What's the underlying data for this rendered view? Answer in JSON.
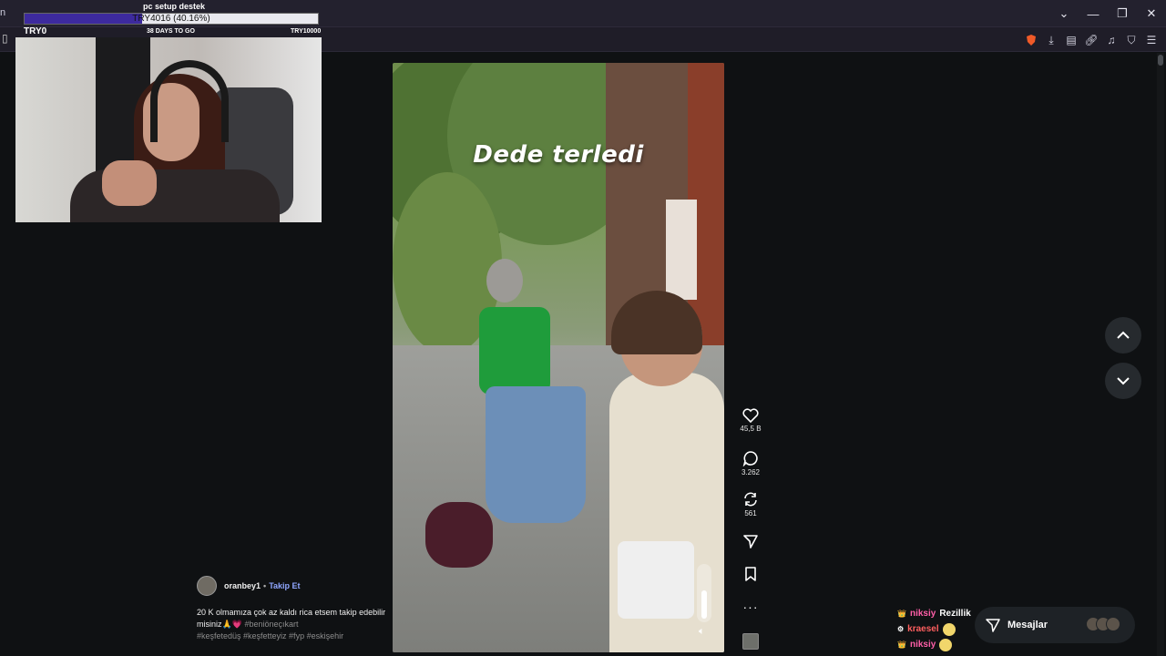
{
  "browser": {
    "tab_stub": "n",
    "window_controls": [
      "chevron-down",
      "minimize",
      "restore",
      "close"
    ],
    "toolbar_icons": [
      "brave-shield-icon",
      "download-icon",
      "save-icon",
      "link-icon",
      "music-icon",
      "shield-icon",
      "menu-icon"
    ]
  },
  "donation": {
    "title": "pc setup destek",
    "amount": "TRY4016 (40.16%)",
    "progress": 0.4016,
    "current": "TRY0",
    "days_left": "38 DAYS TO GO",
    "goal": "TRY10000",
    "fill_color": "#3d2a9e"
  },
  "video": {
    "caption": "Dede terledi",
    "volume": 0.55
  },
  "actions": {
    "likes": "45,5 B",
    "comments": "3.262",
    "reposts": "561"
  },
  "post": {
    "author": "oranbey1",
    "separator": "•",
    "follow_label": "Takip Et",
    "text": "20 K olmamıza çok az kaldı rica etsem takip edebilir misiniz🙏💗",
    "tags_inline": "#beniöneçıkart",
    "tags_line": "#keşfetedüş #keşfetteyiz #fyp #eskişehir"
  },
  "chat": [
    {
      "user": "niksiy",
      "message": "Rezillik",
      "badges": "👑"
    },
    {
      "user": "kraesel",
      "message": "",
      "badges": "⚙"
    },
    {
      "user": "niksiy",
      "message": "",
      "badges": "👑"
    }
  ],
  "messages": {
    "label": "Mesajlar"
  },
  "colors": {
    "accent_link": "#8fa6ff",
    "chat_user": "#ff5fa8"
  }
}
